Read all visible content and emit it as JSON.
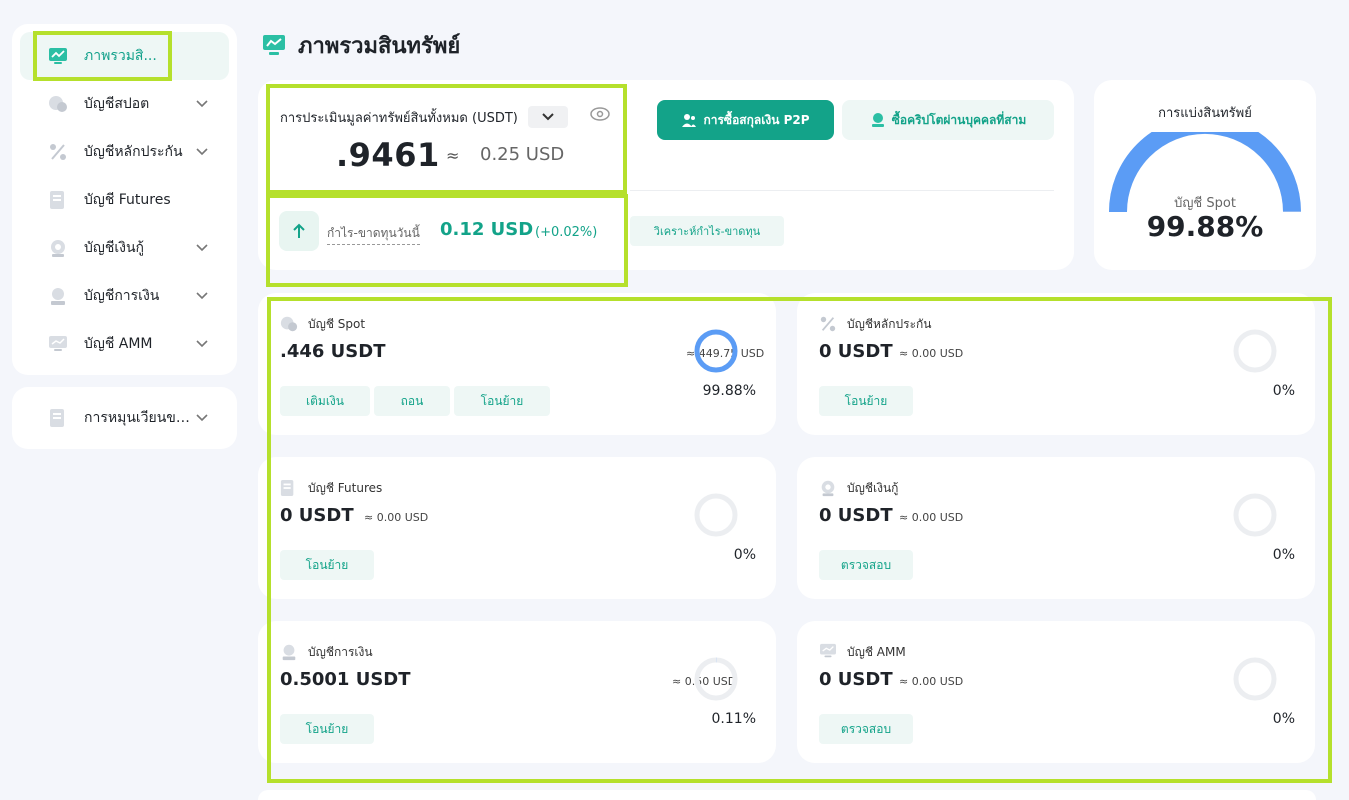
{
  "sidebar": {
    "items": [
      {
        "label": "ภาพรวมสิ...",
        "icon": "chart-trend-icon",
        "active": true
      },
      {
        "label": "บัญชีสปอต",
        "icon": "coins-icon"
      },
      {
        "label": "บัญชีหลักประกัน",
        "icon": "percent-icon"
      },
      {
        "label": "บัญชี Futures",
        "icon": "document-icon"
      },
      {
        "label": "บัญชีเงินกู้",
        "icon": "loan-icon"
      },
      {
        "label": "บัญชีการเงิน",
        "icon": "finance-icon"
      },
      {
        "label": "บัญชี AMM",
        "icon": "monitor-icon"
      }
    ],
    "secondary": {
      "label": "การหมุนเวียนของ..."
    }
  },
  "header": {
    "title": "ภาพรวมสินทรัพย์"
  },
  "overview": {
    "total_label": "การประเมินมูลค่าทรัพย์สินทั้งหมด (USDT)",
    "total_value": ".9461",
    "approx_sign": "≈",
    "approx_value": "0.25 USD",
    "p2p_button": "การซื้อสกุลเงิน P2P",
    "third_party_button": "ซื้อคริปโตผ่านบุคคลที่สาม",
    "pnl_label": "กำไร-ขาดทุนวันนี้",
    "pnl_value": "0.12 USD",
    "pnl_percent": "(+0.02%)",
    "analyze_button": "วิเคราะห์กำไร-ขาดทุน"
  },
  "distribution": {
    "title": "การแบ่งสินทรัพย์",
    "subtitle": "บัญชี Spot",
    "percent": "99.88%",
    "fraction": 0.9988,
    "color": "#5b9cf5"
  },
  "accounts": [
    {
      "name": "บัญชี Spot",
      "value": ".446 USDT",
      "usd": "≈ 449.75 USD",
      "percent": "99.88%",
      "fraction": 0.9988,
      "buttons": [
        "เติมเงิน",
        "ถอน",
        "โอนย้าย"
      ]
    },
    {
      "name": "บัญชีหลักประกัน",
      "value": "0 USDT",
      "usd": "≈ 0.00 USD",
      "percent": "0%",
      "fraction": 0,
      "buttons": [
        "โอนย้าย"
      ]
    },
    {
      "name": "บัญชี Futures",
      "value": "0 USDT",
      "usd": "≈ 0.00 USD",
      "percent": "0%",
      "fraction": 0,
      "buttons": [
        "โอนย้าย"
      ]
    },
    {
      "name": "บัญชีเงินกู้",
      "value": "0 USDT",
      "usd": "≈ 0.00 USD",
      "percent": "0%",
      "fraction": 0,
      "buttons": [
        "ตรวจสอบ"
      ]
    },
    {
      "name": "บัญชีการเงิน",
      "value": "0.5001 USDT",
      "usd": "≈ 0.50 USD",
      "percent": "0.11%",
      "fraction": 0.0011,
      "buttons": [
        "โอนย้าย"
      ]
    },
    {
      "name": "บัญชี AMM",
      "value": "0 USDT",
      "usd": "≈ 0.00 USD",
      "percent": "0%",
      "fraction": 0,
      "buttons": [
        "ตรวจสอบ"
      ]
    }
  ],
  "colors": {
    "accent": "#13a389",
    "highlight": "#b5e02c",
    "ring": "#5b9cf5"
  }
}
